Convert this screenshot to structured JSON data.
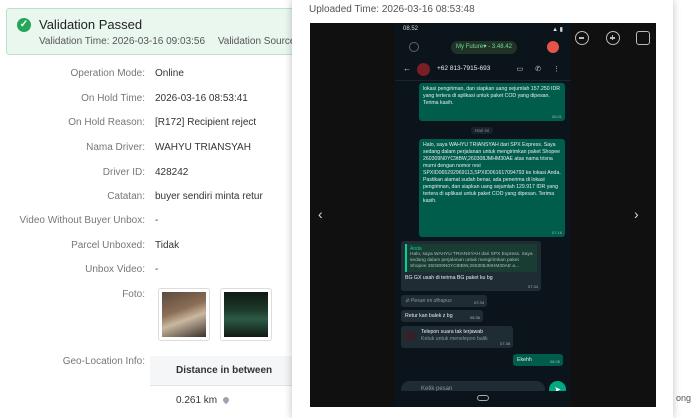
{
  "banner": {
    "title": "Validation Passed",
    "validation_time": "Validation Time: 2026-03-16 09:03:56",
    "validation_source": "Validation Source: Syst"
  },
  "details": [
    {
      "label": "Operation Mode:",
      "value": "Online"
    },
    {
      "label": "On Hold Time:",
      "value": "2026-03-16 08:53:41"
    },
    {
      "label": "On Hold Reason:",
      "value": "[R172] Recipient reject"
    },
    {
      "label": "Nama Driver:",
      "value": "WAHYU TRIANSYAH"
    },
    {
      "label": "Driver ID:",
      "value": "428242"
    },
    {
      "label": "Catatan:",
      "value": "buyer sendiri minta retur"
    },
    {
      "label": "Video Without Buyer Unbox:",
      "value": "-"
    },
    {
      "label": "Parcel Unboxed:",
      "value": "Tidak"
    },
    {
      "label": "Unbox Video:",
      "value": "-"
    }
  ],
  "foto_label": "Foto:",
  "geo": {
    "label": "Geo-Location Info:",
    "header": "Distance in between",
    "value": "0.261 km",
    "overflow_text": "ong"
  },
  "modal": {
    "uploaded_time": "Uploaded Time: 2026-03-16 08:53:48",
    "nav_prev": "‹",
    "nav_next": "›"
  },
  "phone": {
    "clock": "08.52",
    "call_label": "My Future♥ - 3.48.42",
    "contact": "+62 813-7915-693",
    "bubble1": "lokasi pengiriman, dan siapkan uang sejumlah 157.250 IDR yang tertera di aplikasi untuk paket COD yang dipesan. Terima kasih.",
    "bubble1_time": "08.01",
    "date_chip": "Hari ini",
    "bubble2": "Halo, saya WAHYU TRIANSYAH dari SPX Express. Saya sedang dalam perjalanan untuk mengirimkan paket Shopee 260309N0YC9tBW,260308JMHM30AE atas nama trisna murni dengan nomor resi SPXID065292969113,SPXID061617094793 ke lokasi Anda. Pastikan alamat sudah benar, ada penerima di lokasi pengiriman, dan siapkan uang sejumlah 129.917 IDR yang tertera di aplikasi untuk paket COD yang dipesan. Terima kasih.",
    "bubble2_time": "07.16",
    "quote_name": "Anda",
    "quote_text": "Halo, saya WAHYU TRIANSYAH dari SPX Express. Saya sedang dalam perjalanan untuk mengirimkan paket Shopee 260309N0YC9tBW,260308JMHM30AE a...",
    "bubble3": "BG GX usah di terima BG paket ku bg",
    "bubble3_time": "07.34",
    "deleted": "Pesan ini dihapus",
    "deleted_time": "07.34",
    "bubble4": "Retur kan balek z bg",
    "bubble4_time": "08.36",
    "missed_call": "Telepon suara tak terjawab",
    "missed_call_sub": "Ketuk untuk menelepon balik",
    "missed_time": "07.38",
    "bubble5": "Ekehh",
    "bubble5_time": "08.05",
    "input_placeholder": "Ketik pesan",
    "send_icon": "send-icon"
  }
}
